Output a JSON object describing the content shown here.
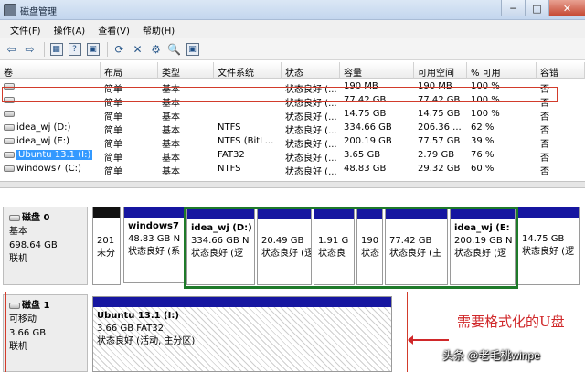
{
  "window": {
    "title": "磁盘管理",
    "buttons": [
      "─",
      "□",
      "✕"
    ]
  },
  "menu": [
    "文件(F)",
    "操作(A)",
    "查看(V)",
    "帮助(H)"
  ],
  "toolbar": {
    "icons": [
      "back-arrow-icon",
      "forward-arrow-icon",
      "properties-icon",
      "help-icon",
      "refresh-icon",
      "delete-icon",
      "settings-icon",
      "search-icon",
      "disk-icon"
    ],
    "glyphs": [
      "⇦",
      "⇨",
      "▦",
      "?",
      "⟳",
      "✕",
      "⚙",
      "🔍",
      "▣"
    ]
  },
  "columns": [
    "卷",
    "布局",
    "类型",
    "文件系统",
    "状态",
    "容量",
    "可用空间",
    "% 可用",
    "容错"
  ],
  "volumes": [
    {
      "vol": "",
      "layout": "简单",
      "type": "基本",
      "fs": "",
      "status": "状态良好 (...",
      "capacity": "190 MB",
      "free": "190 MB",
      "pct": "100 %",
      "fault": "否"
    },
    {
      "vol": "",
      "layout": "简单",
      "type": "基本",
      "fs": "",
      "status": "状态良好 (...",
      "capacity": "77.42 GB",
      "free": "77.42 GB",
      "pct": "100 %",
      "fault": "否"
    },
    {
      "vol": "",
      "layout": "简单",
      "type": "基本",
      "fs": "",
      "status": "状态良好 (...",
      "capacity": "14.75 GB",
      "free": "14.75 GB",
      "pct": "100 %",
      "fault": "否"
    },
    {
      "vol": "idea_wj (D:)",
      "layout": "简单",
      "type": "基本",
      "fs": "NTFS",
      "status": "状态良好 (...",
      "capacity": "334.66 GB",
      "free": "206.36 ...",
      "pct": "62 %",
      "fault": "否"
    },
    {
      "vol": "idea_wj (E:)",
      "layout": "简单",
      "type": "基本",
      "fs": "NTFS (BitL...",
      "status": "状态良好 (...",
      "capacity": "200.19 GB",
      "free": "77.57 GB",
      "pct": "39 %",
      "fault": "否"
    },
    {
      "vol": "Ubuntu 13.1 (I:)",
      "layout": "简单",
      "type": "基本",
      "fs": "FAT32",
      "status": "状态良好 (...",
      "capacity": "3.65 GB",
      "free": "2.79 GB",
      "pct": "76 %",
      "fault": "否"
    },
    {
      "vol": "windows7 (C:)",
      "layout": "简单",
      "type": "基本",
      "fs": "NTFS",
      "status": "状态良好 (...",
      "capacity": "48.83 GB",
      "free": "29.32 GB",
      "pct": "60 %",
      "fault": "否"
    }
  ],
  "disk0": {
    "name": "磁盘 0",
    "type": "基本",
    "size": "698.64 GB",
    "state": "联机",
    "partitions": [
      {
        "lines": [
          "201",
          "未分"
        ],
        "bar": "black"
      },
      {
        "name": "windows7",
        "lines": [
          "48.83 GB N",
          "状态良好 (系"
        ],
        "bar": "blue"
      },
      {
        "name": "idea_wj  (D:)",
        "lines": [
          "334.66 GB N",
          "状态良好 (逻"
        ],
        "bar": "blue"
      },
      {
        "lines": [
          "20.49 GB",
          "状态良好 (逻"
        ],
        "bar": "blue"
      },
      {
        "lines": [
          "1.91 G",
          "状态良"
        ],
        "bar": "blue"
      },
      {
        "lines": [
          "190",
          "状态"
        ],
        "bar": "blue"
      },
      {
        "lines": [
          "77.42 GB",
          "状态良好 (主"
        ],
        "bar": "blue"
      },
      {
        "name": "idea_wj  (E:",
        "lines": [
          "200.19 GB N",
          "状态良好 (逻"
        ],
        "bar": "blue"
      },
      {
        "lines": [
          "14.75 GB",
          "状态良好 (逻"
        ],
        "bar": "blue"
      }
    ]
  },
  "disk1": {
    "name": "磁盘 1",
    "type": "可移动",
    "size": "3.66 GB",
    "state": "联机",
    "partition": {
      "name": "Ubuntu 13.1  (I:)",
      "lines": [
        "3.66 GB FAT32",
        "状态良好 (活动, 主分区)"
      ]
    }
  },
  "annotation": "需要格式化的U盘",
  "watermark": "头条 @老毛桃winpe"
}
